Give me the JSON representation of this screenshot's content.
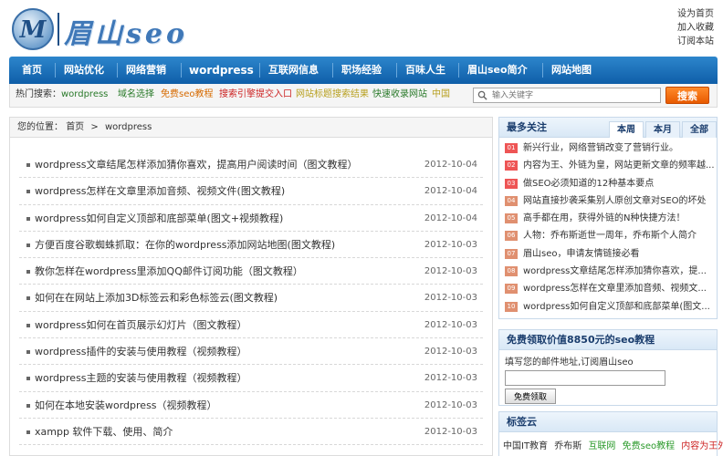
{
  "header": {
    "logo_text": "眉山seo",
    "links": [
      "设为首页",
      "加入收藏",
      "订阅本站"
    ]
  },
  "nav": {
    "items": [
      "首页",
      "网站优化",
      "网络营销",
      "wordpress",
      "互联网信息",
      "职场经验",
      "百味人生",
      "眉山seo简介",
      "网站地图"
    ]
  },
  "hot": {
    "label": "热门搜索：",
    "keywords": [
      {
        "text": "wordpress",
        "color": "#2a7a2a"
      },
      {
        "text": "域名选择",
        "color": "#2a7a2a"
      },
      {
        "text": "免费seo教程",
        "color": "#d66a00"
      },
      {
        "text": "搜索引擎提交入口",
        "color": "#cc2222"
      },
      {
        "text": "网站标题搜索结果",
        "color": "#b8a020"
      },
      {
        "text": "快速收录网站",
        "color": "#2a7a2a"
      },
      {
        "text": "中国",
        "color": "#b8a020"
      }
    ],
    "search_placeholder": "输入关键字",
    "search_button": "搜索"
  },
  "breadcrumb": {
    "label": "您的位置：",
    "home": "首页",
    "sep": ">",
    "current": "wordpress"
  },
  "articles": [
    {
      "title": "wordpress文章结尾怎样添加猜你喜欢，提高用户阅读时间（图文教程）",
      "date": "2012-10-04"
    },
    {
      "title": "wordpress怎样在文章里添加音频、视频文件(图文教程)",
      "date": "2012-10-04"
    },
    {
      "title": "wordpress如何自定义顶部和底部菜单(图文+视频教程)",
      "date": "2012-10-04"
    },
    {
      "title": "方便百度谷歌蜘蛛抓取：在你的wordpress添加网站地图(图文教程)",
      "date": "2012-10-03"
    },
    {
      "title": "教你怎样在wordpress里添加QQ邮件订阅功能（图文教程）",
      "date": "2012-10-03"
    },
    {
      "title": "如何在在网站上添加3D标签云和彩色标签云(图文教程)",
      "date": "2012-10-03"
    },
    {
      "title": "wordpress如何在首页展示幻灯片（图文教程）",
      "date": "2012-10-03"
    },
    {
      "title": "wordpress插件的安装与使用教程（视频教程）",
      "date": "2012-10-03"
    },
    {
      "title": "wordpress主题的安装与使用教程（视频教程）",
      "date": "2012-10-03"
    },
    {
      "title": "如何在本地安装wordpress（视频教程）",
      "date": "2012-10-03"
    },
    {
      "title": "xampp 软件下载、使用、简介",
      "date": "2012-10-03"
    }
  ],
  "most_watched": {
    "title": "最多关注",
    "tabs": [
      "本周",
      "本月",
      "全部"
    ],
    "items": [
      {
        "num": "01",
        "text": "新兴行业，网络营销改变了营销行业。"
      },
      {
        "num": "02",
        "text": "内容为王、外链为皇，网站更新文章的频率越..."
      },
      {
        "num": "03",
        "text": "做SEO必须知道的12种基本要点"
      },
      {
        "num": "04",
        "text": "网站直接抄袭采集别人原创文章对SEO的坏处"
      },
      {
        "num": "05",
        "text": "高手都在用，获得外链的N种快捷方法！"
      },
      {
        "num": "06",
        "text": "人物：乔布斯逝世一周年，乔布斯个人简介"
      },
      {
        "num": "07",
        "text": "眉山seo，申请友情链接必看"
      },
      {
        "num": "08",
        "text": "wordpress文章结尾怎样添加猜你喜欢，提..."
      },
      {
        "num": "09",
        "text": "wordpress怎样在文章里添加音频、视频文..."
      },
      {
        "num": "10",
        "text": "wordpress如何自定义顶部和底部菜单(图文..."
      }
    ]
  },
  "subscribe": {
    "title": "免费领取价值8850元的seo教程",
    "desc": "填写您的邮件地址,订阅眉山seo",
    "button": "免费领取"
  },
  "tag_cloud": {
    "title": "标签云",
    "tags": [
      {
        "text": "中国IT教育",
        "color": "#333333"
      },
      {
        "text": "乔布斯",
        "color": "#333333"
      },
      {
        "text": "互联网",
        "color": "#2a9a2a"
      },
      {
        "text": "免费seo教程",
        "color": "#2a9a2a"
      },
      {
        "text": "内容为王外",
        "color": "#cc2222"
      }
    ]
  }
}
